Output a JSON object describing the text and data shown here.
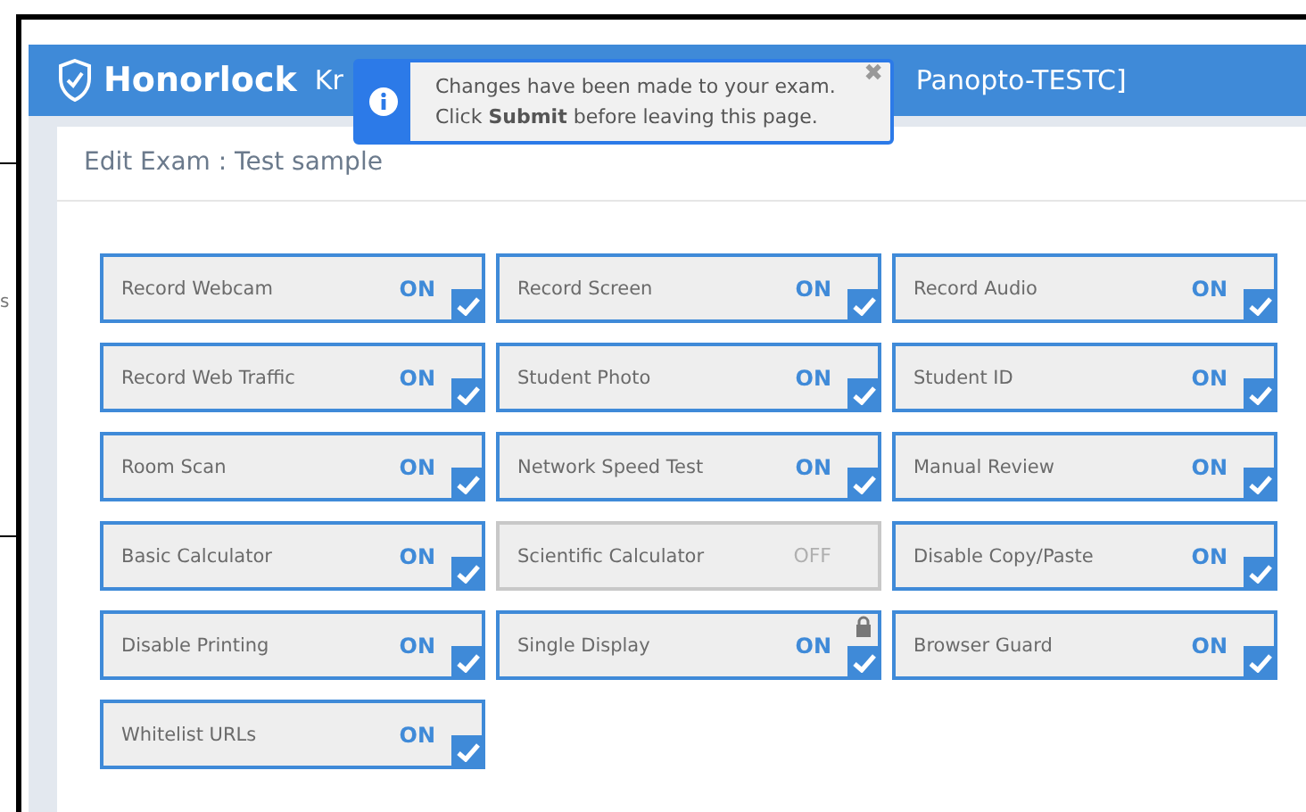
{
  "background_page": {
    "fragment": "s"
  },
  "header": {
    "logo": "Honorlock",
    "title_start": "Kr",
    "title_end": "Panopto-TESTC]"
  },
  "toast": {
    "lines": [
      "Changes have been made to your exam.",
      "Click **Submit** before leaving this page."
    ],
    "close": "✖"
  },
  "card": {
    "title": "Edit Exam : Test sample"
  },
  "settings": [
    {
      "label": "Record Webcam",
      "status": "ON",
      "checked": true,
      "locked": false
    },
    {
      "label": "Record Screen",
      "status": "ON",
      "checked": true,
      "locked": false
    },
    {
      "label": "Record Audio",
      "status": "ON",
      "checked": true,
      "locked": false
    },
    {
      "label": "Record Web Traffic",
      "status": "ON",
      "checked": true,
      "locked": false
    },
    {
      "label": "Student Photo",
      "status": "ON",
      "checked": true,
      "locked": false
    },
    {
      "label": "Student ID",
      "status": "ON",
      "checked": true,
      "locked": false
    },
    {
      "label": "Room Scan",
      "status": "ON",
      "checked": true,
      "locked": false
    },
    {
      "label": "Network Speed Test",
      "status": "ON",
      "checked": true,
      "locked": false
    },
    {
      "label": "Manual Review",
      "status": "ON",
      "checked": true,
      "locked": false
    },
    {
      "label": "Basic Calculator",
      "status": "ON",
      "checked": true,
      "locked": false
    },
    {
      "label": "Scientific Calculator",
      "status": "OFF",
      "checked": false,
      "locked": false
    },
    {
      "label": "Disable Copy/Paste",
      "status": "ON",
      "checked": true,
      "locked": false
    },
    {
      "label": "Disable Printing",
      "status": "ON",
      "checked": true,
      "locked": false
    },
    {
      "label": "Single Display",
      "status": "ON",
      "checked": true,
      "locked": true
    },
    {
      "label": "Browser Guard",
      "status": "ON",
      "checked": true,
      "locked": false
    },
    {
      "label": "Whitelist URLs",
      "status": "ON",
      "checked": true,
      "locked": false
    }
  ]
}
